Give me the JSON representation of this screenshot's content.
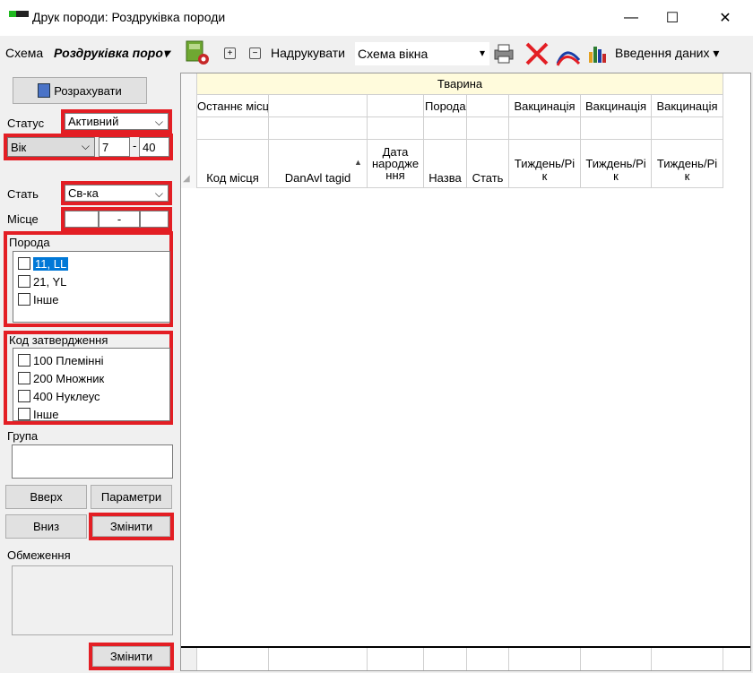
{
  "window": {
    "title": "Друк породи: Роздруківка породи",
    "minimize": "—",
    "maximize": "☐",
    "close": "✕"
  },
  "toolbar": {
    "scheme_label": "Схема",
    "scheme_value": "Роздруківка поро▾",
    "plus_icon": "+",
    "minus_icon": "−",
    "print_label": "Надрукувати",
    "print_select_value": "Схема вікна",
    "data_entry_label": "Введення даних ▾"
  },
  "left": {
    "calc_button": "Розрахувати",
    "status_label": "Статус",
    "status_value": "Активний",
    "age_select_value": "Вік",
    "age_from": "7",
    "age_dash": "-",
    "age_to": "40",
    "sex_label": "Стать",
    "sex_value": "Св-ка",
    "place_label": "Місце",
    "place_dash": "-",
    "breed_group": "Порода",
    "breed_items": [
      "11, LL",
      "21, YL",
      "Інше"
    ],
    "approval_group": "Код затвердження",
    "approval_items": [
      "100 Племінні",
      "200 Множник",
      "400 Нуклеус",
      "Інше"
    ],
    "group_label": "Група",
    "up_button": "Вверх",
    "params_button": "Параметри",
    "down_button": "Вниз",
    "change_button": "Змінити",
    "limits_label": "Обмеження",
    "change_button2": "Змінити"
  },
  "grid": {
    "group_header": "Тварина",
    "row1": [
      "Останнє місц",
      "",
      "",
      "Порода",
      "",
      "Вакцинація",
      "Вакцинація",
      "Вакцинація"
    ],
    "row3": [
      "Код місця",
      "DanAvl tagid",
      "Дата народже ння",
      "Назва",
      "Стать",
      "Тиждень/Рі к",
      "Тиждень/Рі к",
      "Тиждень/Рі к"
    ],
    "sort_icon": "▲"
  },
  "colors": {
    "accent_red": "#e31e24",
    "header_yellow": "#fffbdc"
  }
}
